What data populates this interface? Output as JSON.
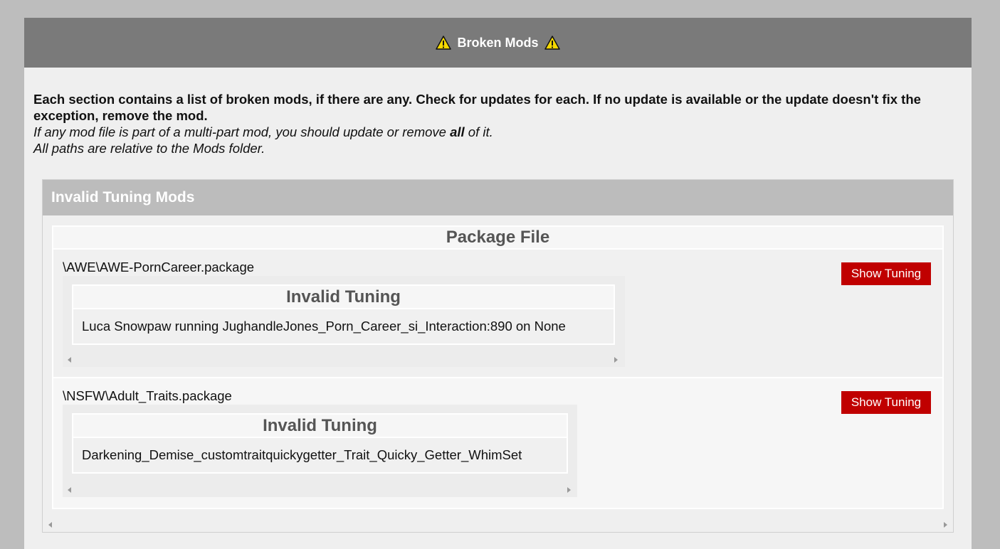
{
  "header": {
    "title": "Broken Mods",
    "warning_icon": "warning-triangle-icon",
    "warning_color": "#f5d800"
  },
  "intro": {
    "bold_text": "Each section contains a list of broken mods, if there are any. Check for updates for each. If no update is available or the update doesn't fix the exception, remove the mod.",
    "italic_line1_pre": "If any mod file is part of a multi-part mod, you should update or remove ",
    "italic_line1_bold": "all",
    "italic_line1_post": " of it.",
    "italic_line2": "All paths are relative to the Mods folder."
  },
  "section": {
    "title": "Invalid Tuning Mods",
    "column_header": "Package File",
    "rows": [
      {
        "path": "\\AWE\\AWE-PornCareer.package",
        "button_label": "Show Tuning",
        "inner_header": "Invalid Tuning",
        "inner_value": "Luca Snowpaw running JughandleJones_Porn_Career_si_Interaction:890 on None"
      },
      {
        "path": "\\NSFW\\Adult_Traits.package",
        "button_label": "Show Tuning",
        "inner_header": "Invalid Tuning",
        "inner_value": "Darkening_Demise_customtraitquickygetter_Trait_Quicky_Getter_WhimSet"
      }
    ]
  },
  "colors": {
    "title_bar": "#7a7a7a",
    "section_header": "#bcbcbc",
    "button": "#c00000"
  }
}
